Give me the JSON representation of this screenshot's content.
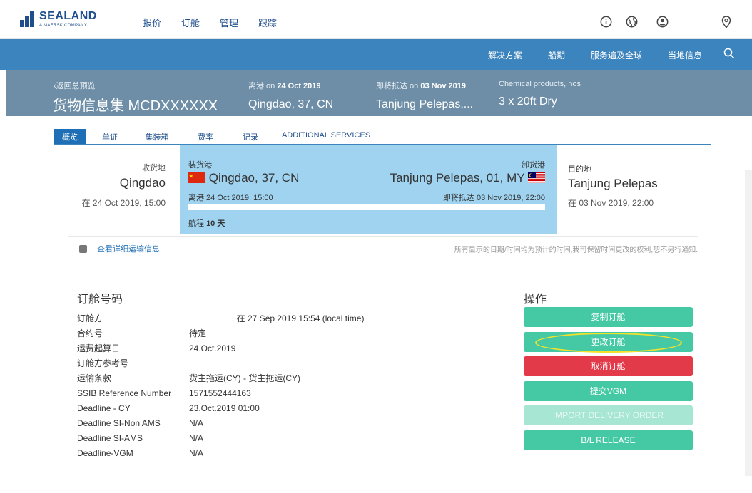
{
  "header": {
    "logo_name": "SEALAND",
    "logo_sub": "A MAERSK COMPANY",
    "nav": [
      "报价",
      "订舱",
      "管理",
      "跟踪"
    ],
    "icons": [
      "info-icon",
      "globe-icon",
      "user-icon",
      "location-pin-icon"
    ]
  },
  "bluenav": {
    "items": [
      "解决方案",
      "船期",
      "服务遍及全球",
      "当地信息"
    ],
    "search_icon": "search-icon"
  },
  "shipment": {
    "back_label": "返回总预览",
    "title": "货物信息集 MCDXXXXXX",
    "departure_label_pre": "离港 on ",
    "departure_date": "24 Oct 2019",
    "departure_port": "Qingdao, 37, CN",
    "arrival_label_pre": "即将抵达 on ",
    "arrival_date": "03 Nov 2019",
    "arrival_port": "Tanjung Pelepas,...",
    "commodity": "Chemical products, nos",
    "containers": "3 x 20ft Dry"
  },
  "tabs": [
    {
      "label": "概览"
    },
    {
      "label": "单证"
    },
    {
      "label": "集装箱"
    },
    {
      "label": "费率"
    },
    {
      "label": "记录"
    },
    {
      "label": "ADDITIONAL SERVICES"
    }
  ],
  "route": {
    "origin_label": "收货地",
    "origin_city": "Qingdao",
    "origin_time": "在 24 Oct 2019, 15:00",
    "pol_label": "装货港",
    "pol_city": "Qingdao, 37, CN",
    "pol_departure": "离港 24 Oct 2019, 15:00",
    "pod_label": "卸货港",
    "pod_city": "Tanjung Pelepas, 01, MY",
    "pod_arrival": "即将抵达 03 Nov 2019, 22:00",
    "transit_label": "航程 ",
    "transit_value": "10 天",
    "dest_label": "目的地",
    "dest_city": "Tanjung Pelepas",
    "dest_time": "在 03 Nov 2019, 22:00"
  },
  "detail_link": "查看详细运输信息",
  "disclaimer": "所有显示的日期/时间均为预计的时间,我司保留时间更改的权利,恕不另行通知.",
  "booking": {
    "title": "订舱号码",
    "rows": [
      {
        "key": "订舱方",
        "value": ". 在 27 Sep 2019 15:54 (local time)"
      },
      {
        "key": "合约号",
        "value": "待定"
      },
      {
        "key": "运费起算日",
        "value": "24.Oct.2019"
      },
      {
        "key": "订舱方参考号",
        "value": ""
      },
      {
        "key": "运输条款",
        "value": "货主拖运(CY) - 货主拖运(CY)"
      },
      {
        "key": "SSIB Reference Number",
        "value": "1571552444163"
      },
      {
        "key": "Deadline - CY",
        "value": "23.Oct.2019 01:00"
      },
      {
        "key": "Deadline SI-Non AMS",
        "value": "N/A"
      },
      {
        "key": "Deadline SI-AMS",
        "value": "N/A"
      },
      {
        "key": "Deadline-VGM",
        "value": "N/A"
      }
    ]
  },
  "actions": {
    "title": "操作",
    "buttons": [
      {
        "label": "复制订舱",
        "style": "green"
      },
      {
        "label": "更改订舱",
        "style": "green"
      },
      {
        "label": "取消订舱",
        "style": "red"
      },
      {
        "label": "提交VGM",
        "style": "green"
      },
      {
        "label": "IMPORT DELIVERY ORDER",
        "style": "disabled"
      },
      {
        "label": "B/L RELEASE",
        "style": "green"
      }
    ]
  },
  "colors": {
    "brand": "#1f4e8c",
    "nav_blue": "#3c84bd",
    "header_grey": "#6d8ea6",
    "route_highlight": "#9fd3f0",
    "button_green": "#45c9a4",
    "button_red": "#e33a4a",
    "annotation_yellow": "#f4e12a"
  }
}
